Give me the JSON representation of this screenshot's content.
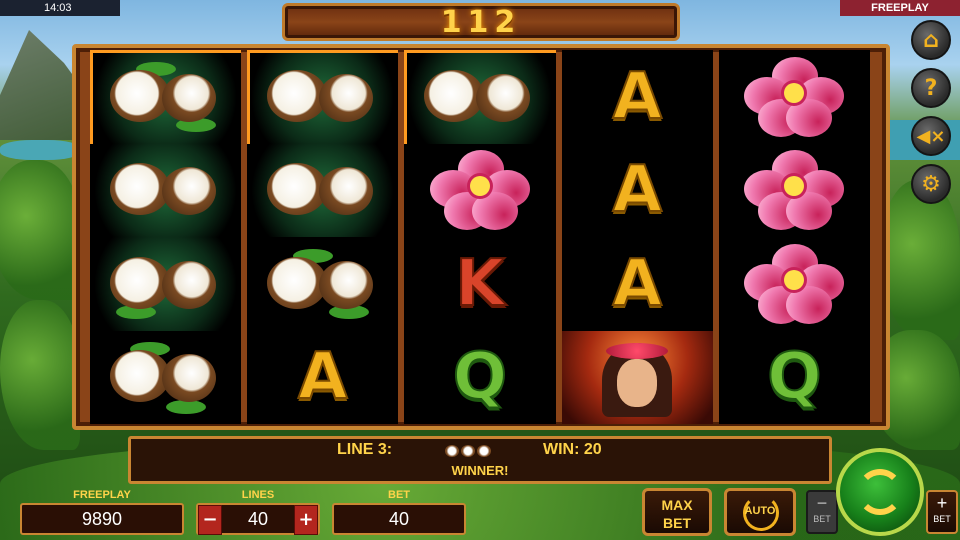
{
  "status_bar": {
    "time": "14:03",
    "mode": "FREEPLAY"
  },
  "header": {
    "win_amount": "112"
  },
  "reels": [
    [
      "coconut",
      "coconut",
      "coconut",
      "coconut"
    ],
    [
      "coconut",
      "coconut",
      "coconut",
      "A"
    ],
    [
      "coconut",
      "flower",
      "K",
      "Q"
    ],
    [
      "A",
      "A",
      "A",
      "girl"
    ],
    [
      "flower",
      "flower",
      "flower",
      "Q"
    ]
  ],
  "message": {
    "line_label": "LINE 3:",
    "win_label": "WIN: 20",
    "status": "WINNER!"
  },
  "panel": {
    "credits_label": "FREEPLAY",
    "credits_value": "9890",
    "lines_label": "LINES",
    "lines_value": "40",
    "lines_minus": "−",
    "lines_plus": "+",
    "bet_label": "BET",
    "bet_value": "40"
  },
  "controls": {
    "maxbet_line1": "MAX",
    "maxbet_line2": "BET",
    "auto_label": "AUTO",
    "bet_minus_sym": "−",
    "bet_minus_label": "BET",
    "bet_plus_sym": "+",
    "bet_plus_label": "BET"
  },
  "side_buttons": [
    "home-icon",
    "help-icon",
    "sound-off-icon",
    "settings-icon"
  ],
  "colors": {
    "accent_gold": "#ffd34a",
    "frame_brown": "#8a4418",
    "mode_red": "#8d2230",
    "spin_green": "#17801a"
  }
}
